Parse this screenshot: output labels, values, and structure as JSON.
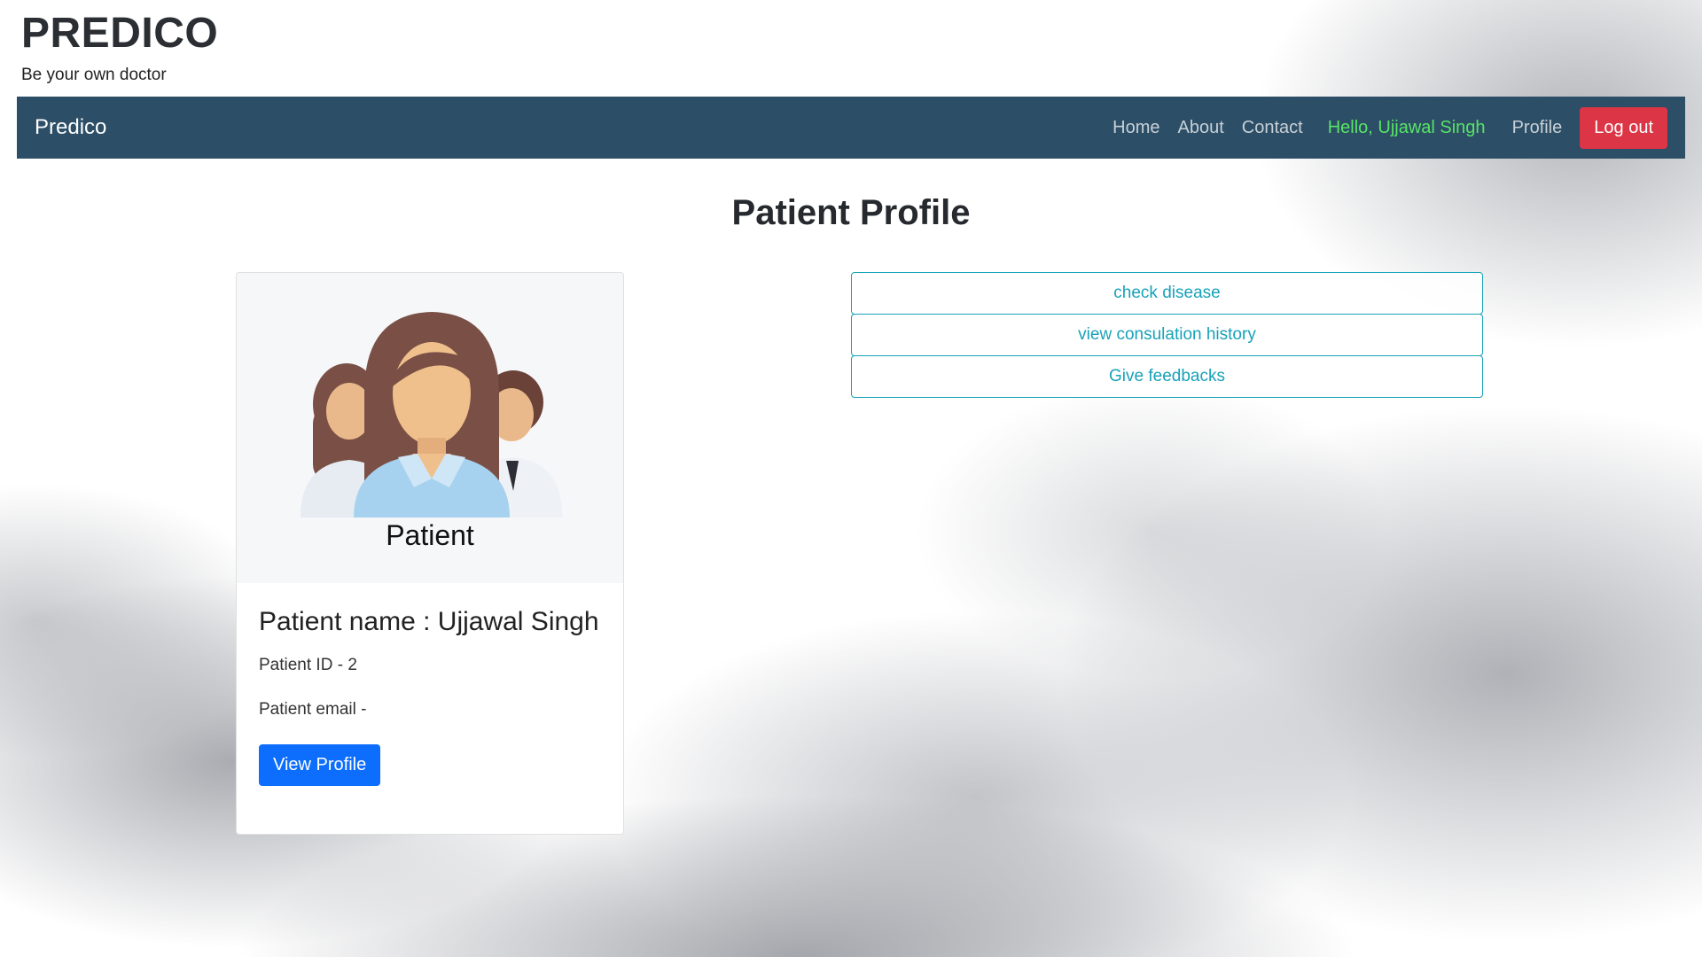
{
  "header": {
    "title": "PREDICO",
    "tagline": "Be your own doctor"
  },
  "navbar": {
    "brand": "Predico",
    "links": [
      "Home",
      "About",
      "Contact"
    ],
    "greeting": "Hello, Ujjawal Singh",
    "profile": "Profile",
    "logout": "Log out"
  },
  "page": {
    "heading": "Patient Profile"
  },
  "card": {
    "image_caption": "Patient",
    "title": "Patient name : Ujjawal Singh",
    "patient_id": "Patient ID - 2",
    "patient_email": "Patient email -",
    "button": "View Profile"
  },
  "actions": [
    "check disease",
    "view consulation history",
    "Give feedbacks"
  ],
  "colors": {
    "navbar": "#2c4e67",
    "greeting": "#58e466",
    "logout": "#dc3545",
    "primary": "#0d6efd",
    "info": "#17a2b8"
  }
}
